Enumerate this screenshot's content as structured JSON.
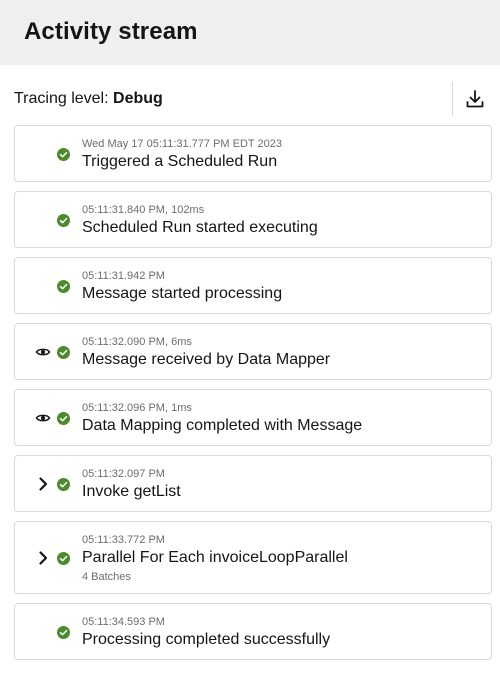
{
  "header": {
    "title": "Activity stream"
  },
  "toolbar": {
    "tracing_label": "Tracing level:",
    "tracing_value": "Debug",
    "download_icon": "download-icon"
  },
  "colors": {
    "success": "#4c8a2e",
    "header_bg": "#f1efed",
    "border": "#dcd9d5"
  },
  "events": [
    {
      "time": "Wed May 17 05:11:31.777 PM EDT 2023",
      "title": "Triggered a Scheduled Run",
      "lead": "",
      "status": "success"
    },
    {
      "time": "05:11:31.840 PM, 102ms",
      "title": "Scheduled Run started executing",
      "lead": "",
      "status": "success"
    },
    {
      "time": "05:11:31.942 PM",
      "title": "Message started processing",
      "lead": "",
      "status": "success"
    },
    {
      "time": "05:11:32.090 PM, 6ms",
      "title": "Message received by Data Mapper",
      "lead": "eye-icon",
      "status": "success"
    },
    {
      "time": "05:11:32.096 PM, 1ms",
      "title": "Data Mapping completed with Message",
      "lead": "eye-icon",
      "status": "success"
    },
    {
      "time": "05:11:32.097 PM",
      "title": "Invoke getList",
      "lead": "chevron-right-icon",
      "status": "success"
    },
    {
      "time": "05:11:33.772 PM",
      "title": "Parallel For Each invoiceLoopParallel",
      "sub": "4 Batches",
      "lead": "chevron-right-icon",
      "status": "success"
    },
    {
      "time": "05:11:34.593 PM",
      "title": "Processing completed successfully",
      "lead": "",
      "status": "success"
    }
  ]
}
